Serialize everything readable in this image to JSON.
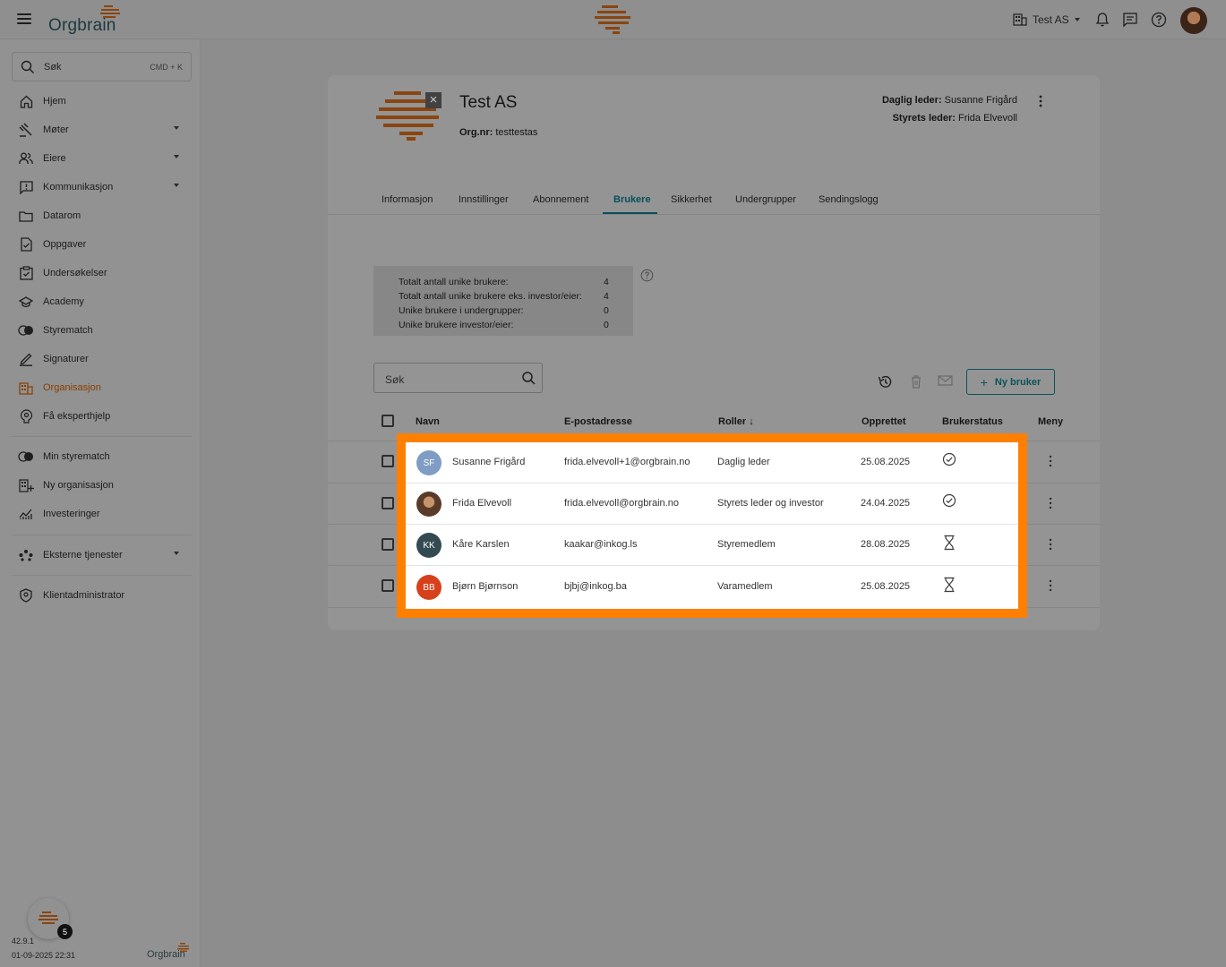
{
  "topbar": {
    "logo_text": "Orgbrain",
    "org_switcher_label": "Test AS"
  },
  "sidebar": {
    "search_label": "Søk",
    "search_shortcut": "CMD + K",
    "items": [
      {
        "label": "Hjem",
        "icon": "home-icon"
      },
      {
        "label": "Møter",
        "icon": "gavel-icon",
        "expandable": true
      },
      {
        "label": "Eiere",
        "icon": "people-icon",
        "expandable": true
      },
      {
        "label": "Kommunikasjon",
        "icon": "chat-alert-icon",
        "expandable": true
      },
      {
        "label": "Datarom",
        "icon": "folder-icon"
      },
      {
        "label": "Oppgaver",
        "icon": "task-icon"
      },
      {
        "label": "Undersøkelser",
        "icon": "survey-icon"
      },
      {
        "label": "Academy",
        "icon": "school-icon"
      },
      {
        "label": "Styrematch",
        "icon": "toggle-circles-icon"
      },
      {
        "label": "Signaturer",
        "icon": "pen-icon"
      },
      {
        "label": "Organisasjon",
        "icon": "building-icon",
        "active": true
      },
      {
        "label": "Få eksperthjelp",
        "icon": "expert-help-icon"
      }
    ],
    "secondary_items": [
      {
        "label": "Min styrematch",
        "icon": "toggle-circles-icon"
      },
      {
        "label": "Ny organisasjon",
        "icon": "add-building-icon"
      },
      {
        "label": "Investeringer",
        "icon": "chart-icon"
      }
    ],
    "external_item": {
      "label": "Eksterne tjenester",
      "icon": "apps-icon"
    },
    "admin_item": {
      "label": "Klientadministrator",
      "icon": "shield-icon"
    },
    "version": "42.9.1",
    "version_date": "01-09-2025 22:31",
    "footer_logo": "Orgbrain",
    "chat_badge": "5"
  },
  "org": {
    "title": "Test AS",
    "org_nr_label": "Org.nr:",
    "org_nr_value": "testtestas",
    "daglig_leder_label": "Daglig leder:",
    "daglig_leder_value": "Susanne Frigård",
    "styrets_leder_label": "Styrets leder:",
    "styrets_leder_value": "Frida Elvevoll"
  },
  "tabs": [
    "Informasjon",
    "Innstillinger",
    "Abonnement",
    "Brukere",
    "Sikkerhet",
    "Undergrupper",
    "Sendingslogg"
  ],
  "active_tab": "Brukere",
  "stats": [
    {
      "label": "Totalt antall unike brukere:",
      "value": "4"
    },
    {
      "label": "Totalt antall unike brukere eks. investor/eier:",
      "value": "4"
    },
    {
      "label": "Unike brukere i undergrupper:",
      "value": "0"
    },
    {
      "label": "Unike brukere investor/eier:",
      "value": "0"
    }
  ],
  "table": {
    "search_placeholder": "Søk",
    "new_user_label": "Ny bruker",
    "headers": {
      "name": "Navn",
      "email": "E-postadresse",
      "roles": "Roller",
      "created": "Opprettet",
      "status": "Brukerstatus",
      "menu": "Meny"
    },
    "rows": [
      {
        "initials": "SF",
        "avatar_color": "#7f9cc4",
        "name": "Susanne Frigård",
        "email": "frida.elvevoll+1@orgbrain.no",
        "role": "Daglig leder",
        "created": "25.08.2025",
        "status": "check-circle-icon"
      },
      {
        "initials": "",
        "avatar_color": "#5a3a28",
        "name": "Frida Elvevoll",
        "email": "frida.elvevoll@orgbrain.no",
        "role": "Styrets leder og investor",
        "created": "24.04.2025",
        "status": "check-circle-icon"
      },
      {
        "initials": "KK",
        "avatar_color": "#344a52",
        "name": "Kåre Karslen",
        "email": "kaakar@inkog.ls",
        "role": "Styremedlem",
        "created": "28.08.2025",
        "status": "hourglass-icon"
      },
      {
        "initials": "BB",
        "avatar_color": "#d6401b",
        "name": "Bjørn Bjørnson",
        "email": "bjbj@inkog.ba",
        "role": "Varamedlem",
        "created": "25.08.2025",
        "status": "hourglass-icon"
      }
    ]
  },
  "colors": {
    "highlight": "#ff7f00",
    "accent": "#07505a",
    "brand_orange": "#e46b14"
  }
}
